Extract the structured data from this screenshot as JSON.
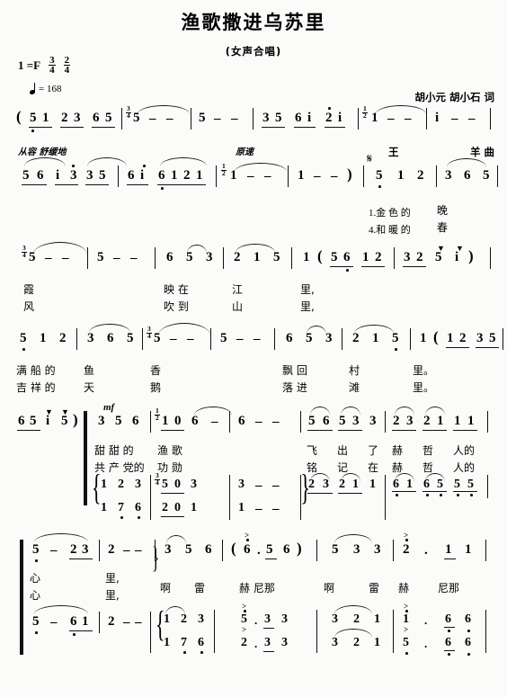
{
  "header": {
    "title": "渔歌撒进乌苏里",
    "subtitle": "(女声合唱)",
    "key_label": "1 =F",
    "time_signature_1": {
      "num": "3",
      "den": "4"
    },
    "time_signature_2": {
      "num": "2",
      "den": "4"
    },
    "tempo_text": "= 168",
    "lyricist": "胡小元 胡小石 词",
    "composer_left": "王",
    "composer_right": "羊 曲"
  },
  "expressions": {
    "congrong": "从容 舒缓地",
    "yuansu": "原速",
    "mf": "mf"
  },
  "systems": [
    {
      "id": "intro-1",
      "notes": "( 5 1  2 3  6 5 | 5 - - | 5 - - | 3 5  6 i  2̇ i | 1 - - | i - - |",
      "time_marks": [
        "3/4",
        "1/2"
      ]
    },
    {
      "id": "intro-2",
      "notes": "5 6  i 3̇  3 5 | 6 i  6 1 2 1 | 1 - - | 1 - - ) | 5 1 2 | 3 6 5 |",
      "time_marks": [
        "1/2"
      ],
      "lyrics_1": "1.金 色 的  晚",
      "lyrics_2": "4.和 暖 的  春"
    },
    {
      "id": "verse-1",
      "notes": "5 - - | 5 - - | 6 5 3 | 2 1 5 | 1 ( 5 6  1 2 | 3 2  5 i ) |",
      "time_marks": [
        "3/4"
      ],
      "lyrics_1": "霞          映 在      江      里,",
      "lyrics_2": "风          吹 到      山      里,"
    },
    {
      "id": "verse-2",
      "notes": "5 1 2 | 3 6 5 | 5 - - | 5 - - | 6 5 3 | 2 1 5 | 1 ( 1 2  3 5 |",
      "time_marks": [
        "3/4"
      ],
      "lyrics_1": "满 船 的  鱼      香          飘 回    村      里。",
      "lyrics_2": "吉 祥 的  天      鹅          落 进    滩      里。"
    },
    {
      "id": "chorus-upper",
      "notes": "6 5  i 5 ) | 3 5 6 | 1 0  6 - | 6 - - | 5 6  5 3  3 | 2 3  2 1  1 1 |",
      "time_marks": [
        "1/2"
      ],
      "lyrics_1": "甜 甜 的  渔 歌            飞   出   了 赫   哲   人的",
      "lyrics_2": "共 产 党的 功 勋            铭   记   在 赫   哲   人的"
    },
    {
      "id": "chorus-lower",
      "notes": "{ 1 2 3 | 5 0 3 | 3 - - }  2 3  2 1  1 | 6 1  6 5  5 5 |",
      "notes_b": "1 7̣ 6̣ | 2 0 1 | 1 - -"
    },
    {
      "id": "refrain-upper",
      "notes": "5̣ -  2 3 | 2 - - | 3 5 6 | ( 6̇ . 5  6 ) | 5 3 3 | 2̇ .  1 1 |",
      "lyrics_1": "心     里,}    啊  雷    赫 尼那  啊    雷 赫  尼那",
      "lyrics_2": "心     里,"
    },
    {
      "id": "refrain-lower",
      "notes": "5̣ -  6̣ 1 | 2 - - | { 1 2 3 | 5̇ . 3 3 | 3 2 1 | 1̇ . 6̣ 6̣ }",
      "notes_b": "1 7̣ 6̣ | 2̇ . 3 3 | 3 2 1 | 5̣ . 6̣ 6̣"
    }
  ],
  "lyrics_blocks": [
    {
      "line1": "1.金 色 的",
      "line2": "4.和 暖 的",
      "w1": "晚",
      "w2": "春"
    },
    {
      "line1": "霞",
      "line2": "风"
    },
    {
      "line1": "映 在",
      "line2": "吹 到"
    },
    {
      "line1": "江",
      "line2": "山"
    },
    {
      "line1": "里,",
      "line2": "里,"
    },
    {
      "line1": "满 船 的",
      "line2": "吉 祥 的"
    },
    {
      "line1": "鱼",
      "line2": "天"
    },
    {
      "line1": "香",
      "line2": "鹅"
    },
    {
      "line1": "飘 回",
      "line2": "落 进"
    },
    {
      "line1": "村",
      "line2": "滩"
    },
    {
      "line1": "里。",
      "line2": "里。"
    },
    {
      "line1": "甜 甜 的",
      "line2": "共 产 党的"
    },
    {
      "line1": "渔 歌",
      "line2": "功 勋"
    },
    {
      "line1": "飞",
      "line2": "铭"
    },
    {
      "line1": "出",
      "line2": "记"
    },
    {
      "line1": "了",
      "line2": "在"
    },
    {
      "line1": "赫",
      "line2": "赫"
    },
    {
      "line1": "哲",
      "line2": "哲"
    },
    {
      "line1": "人的",
      "line2": "人的"
    },
    {
      "line1": "心",
      "line2": "心"
    },
    {
      "line1": "里,",
      "line2": "里,"
    },
    {
      "line1": "啊",
      "line2": "啊"
    },
    {
      "line1": "雷",
      "line2": "雷"
    },
    {
      "line1": "赫 尼那",
      "line2": "赫"
    },
    {
      "line1": "尼那",
      "line2": "尼那"
    }
  ],
  "colors": {
    "ink": "#111111",
    "paper": "#fbfbf9"
  }
}
